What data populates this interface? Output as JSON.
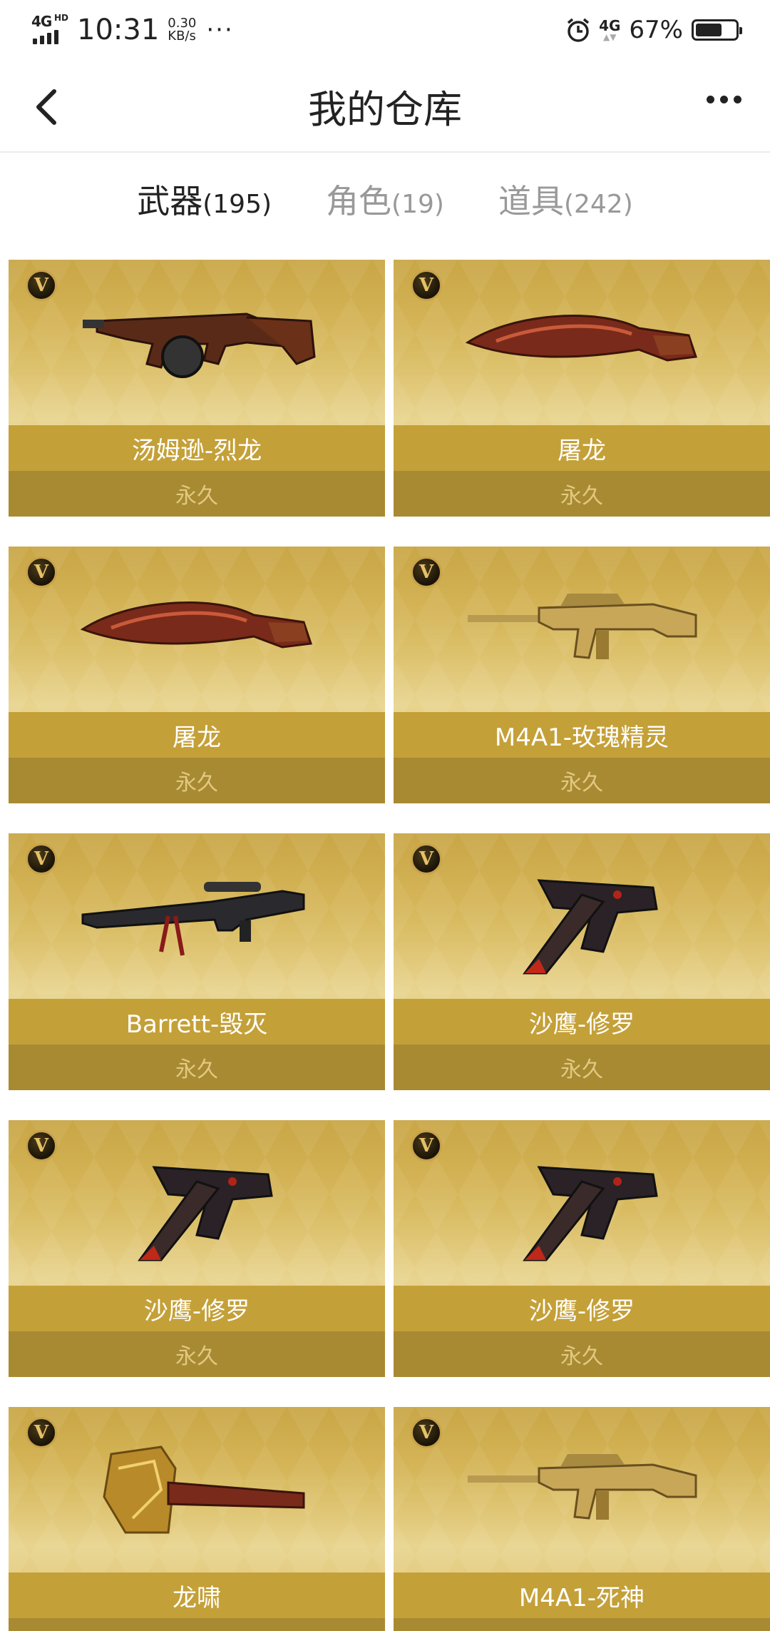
{
  "status_bar": {
    "network": "4G",
    "network_hd": "HD",
    "time": "10:31",
    "speed_value": "0.30",
    "speed_unit": "KB/s",
    "more": "···",
    "secondary_network": "4G",
    "battery_percent": "67%",
    "battery_level": 0.67
  },
  "header": {
    "title": "我的仓库"
  },
  "tabs": [
    {
      "label": "武器",
      "count": "(195)",
      "active": true
    },
    {
      "label": "角色",
      "count": "(19)",
      "active": false
    },
    {
      "label": "道具",
      "count": "(242)",
      "active": false
    }
  ],
  "items": [
    {
      "name": "汤姆逊-烈龙",
      "duration": "永久",
      "badge": "V",
      "icon": "tommy-gun-icon"
    },
    {
      "name": "屠龙",
      "duration": "永久",
      "badge": "V",
      "icon": "kukri-knife-icon"
    },
    {
      "name": "屠龙",
      "duration": "永久",
      "badge": "V",
      "icon": "kukri-knife-icon"
    },
    {
      "name": "M4A1-玫瑰精灵",
      "duration": "永久",
      "badge": "V",
      "icon": "assault-rifle-icon"
    },
    {
      "name": "Barrett-毁灭",
      "duration": "永久",
      "badge": "V",
      "icon": "sniper-rifle-icon"
    },
    {
      "name": "沙鹰-修罗",
      "duration": "永久",
      "badge": "V",
      "icon": "pistol-icon"
    },
    {
      "name": "沙鹰-修罗",
      "duration": "永久",
      "badge": "V",
      "icon": "pistol-icon"
    },
    {
      "name": "沙鹰-修罗",
      "duration": "永久",
      "badge": "V",
      "icon": "pistol-icon"
    },
    {
      "name": "龙啸",
      "duration": "",
      "badge": "V",
      "icon": "axe-icon"
    },
    {
      "name": "M4A1-死神",
      "duration": "",
      "badge": "V",
      "icon": "assault-rifle-icon"
    }
  ],
  "colors": {
    "card_gold": "#d6b75a",
    "name_bar": "#c4a038",
    "duration_bar": "#a88a33",
    "duration_text": "#e3c980"
  }
}
